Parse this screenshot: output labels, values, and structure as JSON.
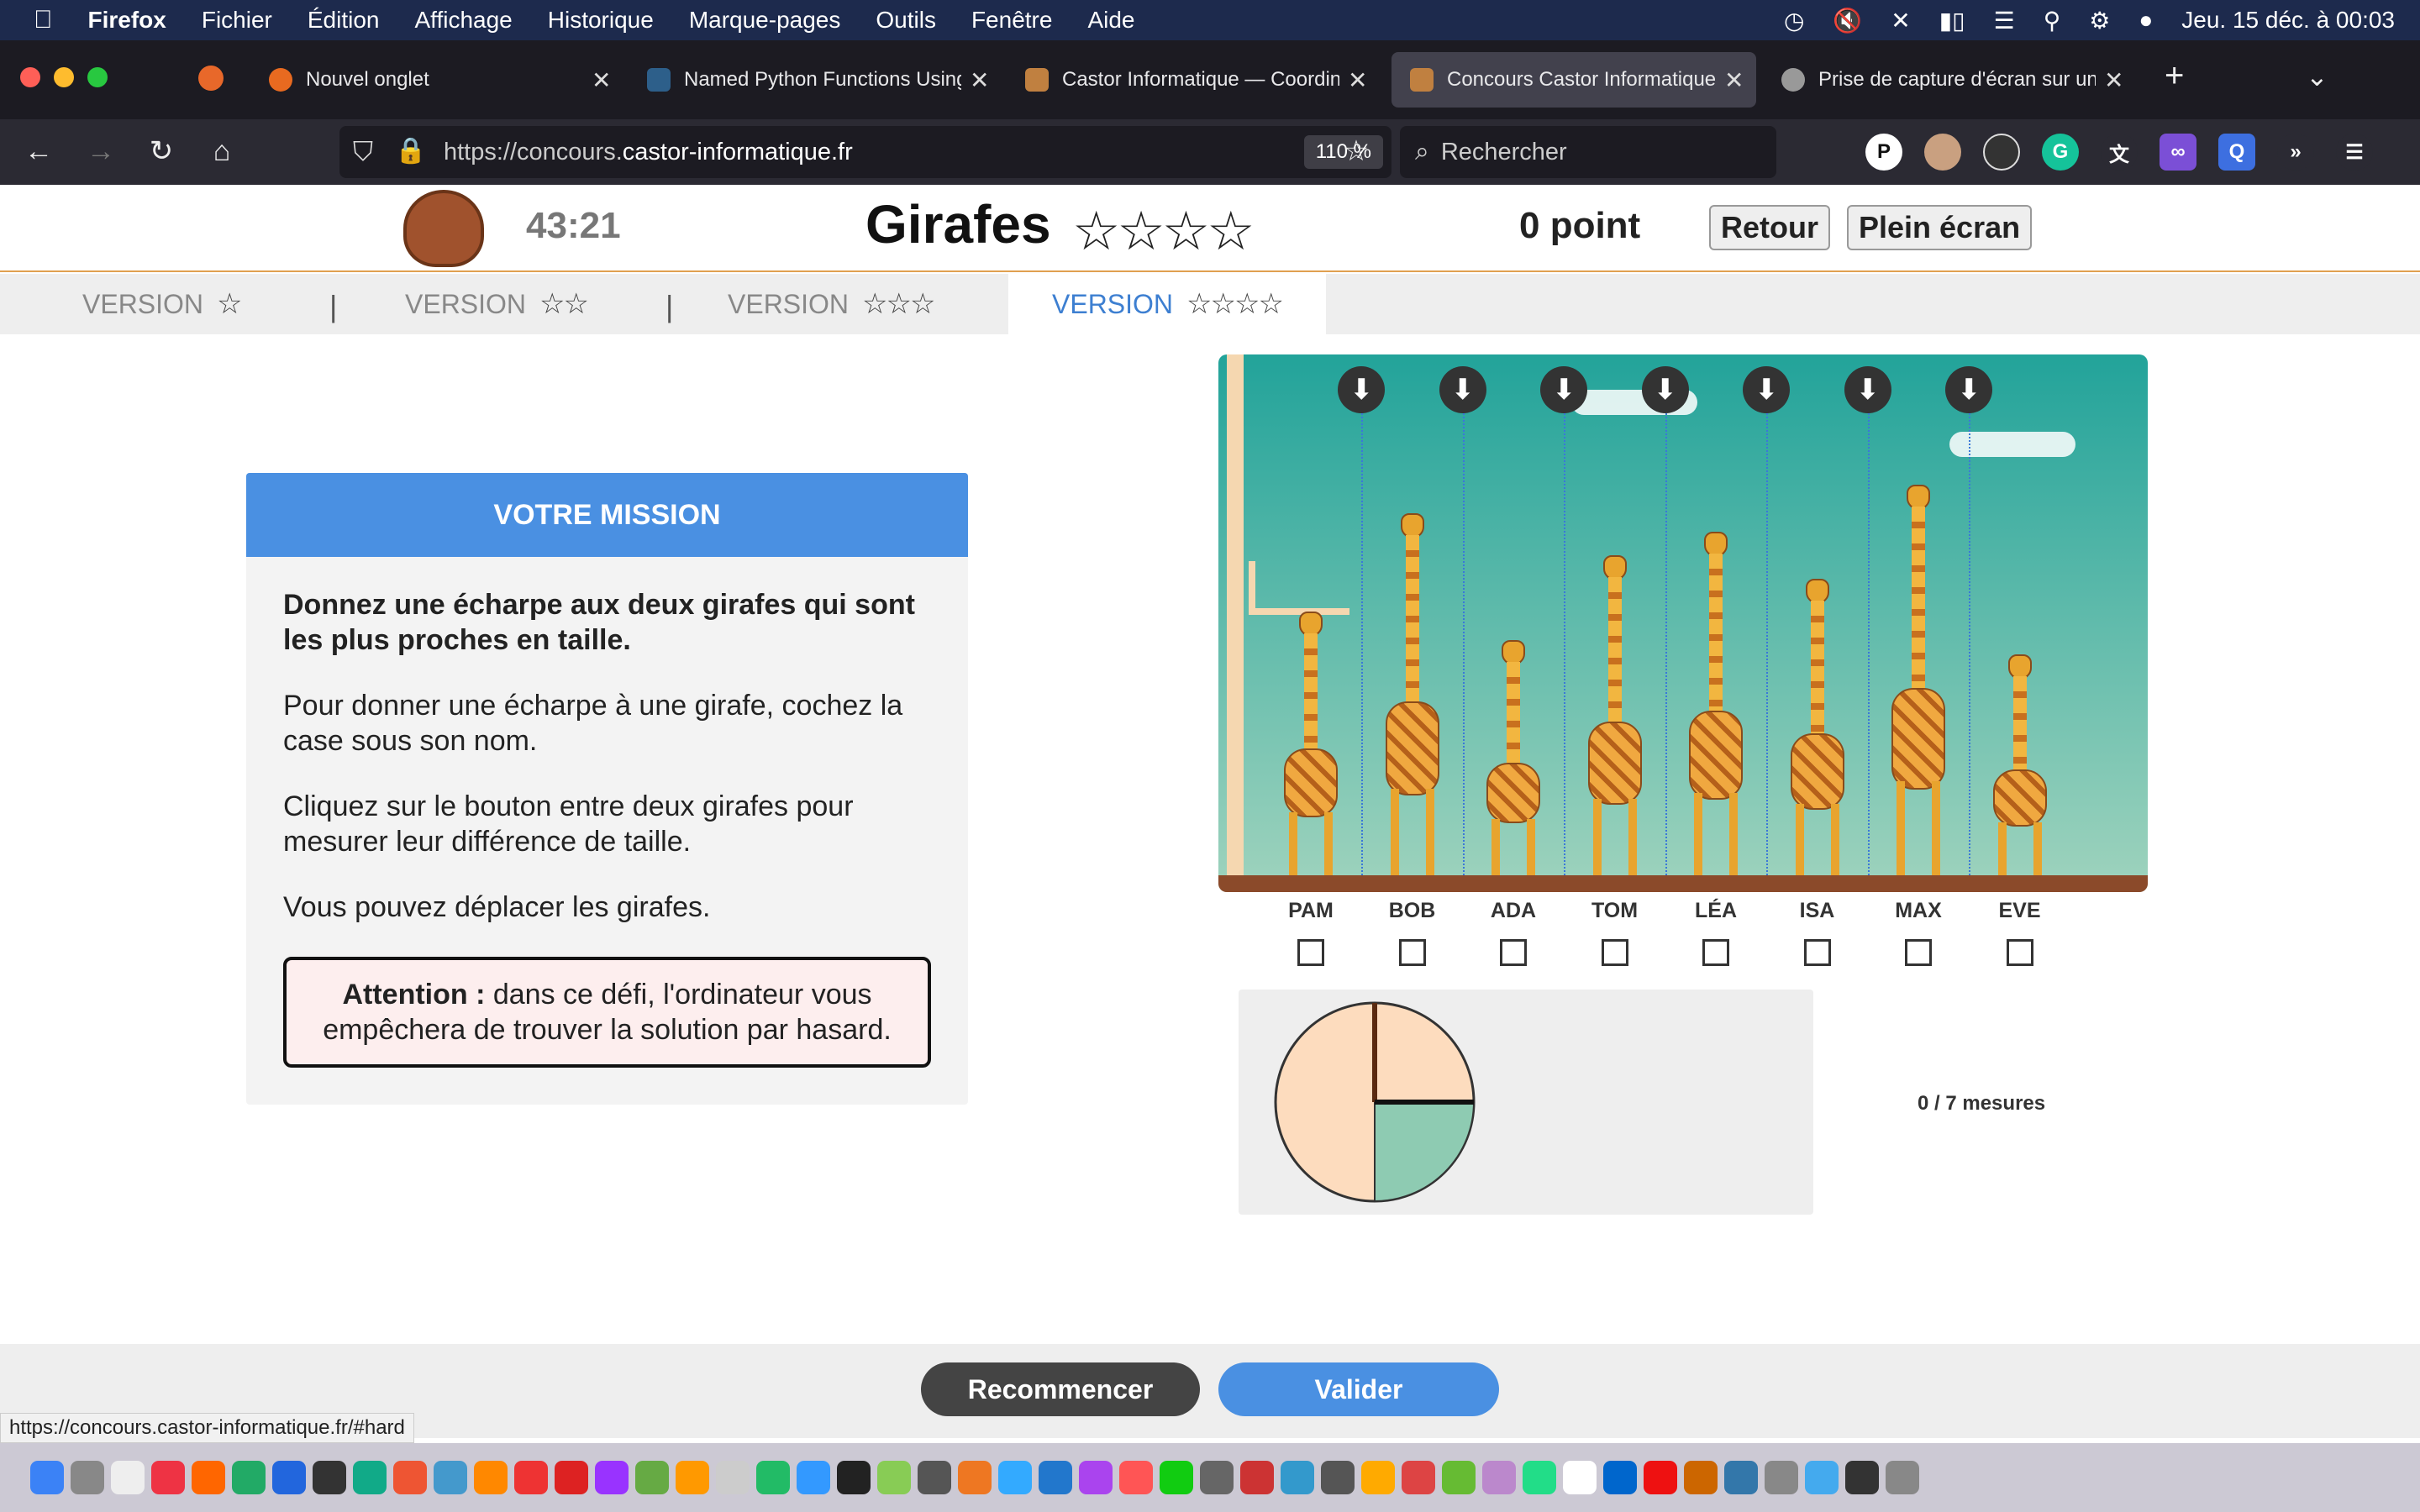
{
  "menubar": {
    "app": "Firefox",
    "items": [
      "Fichier",
      "Édition",
      "Affichage",
      "Historique",
      "Marque-pages",
      "Outils",
      "Fenêtre",
      "Aide"
    ],
    "clock": "Jeu. 15 déc. à  00:03"
  },
  "tabs": [
    {
      "title": "Nouvel onglet",
      "color": "#e86a20"
    },
    {
      "title": "Named Python Functions Using",
      "color": "#2d5f8a"
    },
    {
      "title": "Castor Informatique — Coordina",
      "color": "#c08040"
    },
    {
      "title": "Concours Castor Informatique –",
      "color": "#c08040",
      "active": true
    },
    {
      "title": "Prise de capture d'écran sur un",
      "color": "#999"
    }
  ],
  "nav": {
    "url_prefix": "https://concours.",
    "url_domain": "castor-informatique.fr",
    "zoom": "110 %",
    "search_placeholder": "Rechercher"
  },
  "header": {
    "timer": "43:21",
    "title": "Girafes",
    "stars": "☆☆☆☆",
    "points": "0 point",
    "back_label": "Retour",
    "fullscreen_label": "Plein écran"
  },
  "versions": [
    {
      "label": "VERSION",
      "stars": "☆"
    },
    {
      "label": "VERSION",
      "stars": "☆☆"
    },
    {
      "label": "VERSION",
      "stars": "☆☆☆"
    },
    {
      "label": "VERSION",
      "stars": "☆☆☆☆",
      "active": true
    }
  ],
  "mission": {
    "heading": "VOTRE MISSION",
    "lead": "Donnez une écharpe aux deux girafes qui sont les plus proches en taille.",
    "p1": "Pour donner une écharpe à une girafe, cochez la case sous son nom.",
    "p2": "Cliquez sur le bouton entre deux girafes pour mesurer leur différence de taille.",
    "p3": "Vous pouvez déplacer les girafes.",
    "attention_bold": "Attention :",
    "attention_text": " dans ce défi, l'ordinateur vous empêchera de trouver la solution par hasard."
  },
  "giraffes": [
    {
      "name": "PAM",
      "height": 0.56
    },
    {
      "name": "BOB",
      "height": 0.77
    },
    {
      "name": "ADA",
      "height": 0.5
    },
    {
      "name": "TOM",
      "height": 0.68
    },
    {
      "name": "LÉA",
      "height": 0.73
    },
    {
      "name": "ISA",
      "height": 0.63
    },
    {
      "name": "MAX",
      "height": 0.83
    },
    {
      "name": "EVE",
      "height": 0.47
    }
  ],
  "measures": {
    "text": "0 / 7 mesures"
  },
  "footer": {
    "restart_label": "Recommencer",
    "validate_label": "Valider"
  },
  "status_url": "https://concours.castor-informatique.fr/#hard",
  "colors": {
    "accent": "#4a90e2",
    "restart": "#444",
    "sky_top": "#22a39a",
    "sky_bottom": "#9fd3bd",
    "pie_fill": "#fddcbe",
    "pie_green": "#8ecbb2"
  }
}
